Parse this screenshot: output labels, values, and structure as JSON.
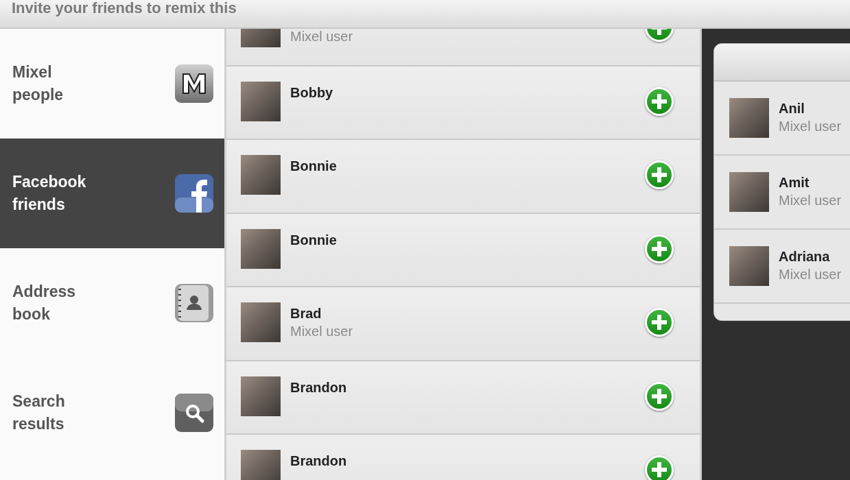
{
  "header": {
    "title": "Invite your friends to remix this"
  },
  "sidebar": {
    "items": [
      {
        "label": "Mixel people",
        "kind": "mixel",
        "selected": false
      },
      {
        "label": "Facebook friends",
        "kind": "facebook",
        "selected": true
      },
      {
        "label": "Address book",
        "kind": "contacts",
        "selected": false
      },
      {
        "label": "Search results",
        "kind": "search",
        "selected": false
      }
    ]
  },
  "friends": [
    {
      "subtitle": "Mixel user"
    },
    {
      "name": "Bobby"
    },
    {
      "name": "Bonnie"
    },
    {
      "name": "Bonnie"
    },
    {
      "name": "Brad",
      "subtitle": "Mixel user"
    },
    {
      "name": "Brandon"
    },
    {
      "name": "Brandon"
    }
  ],
  "invited": [
    {
      "name": "Anil",
      "subtitle": "Mixel user"
    },
    {
      "name": "Amit",
      "subtitle": "Mixel user"
    },
    {
      "name": "Adriana",
      "subtitle": "Mixel user"
    }
  ]
}
